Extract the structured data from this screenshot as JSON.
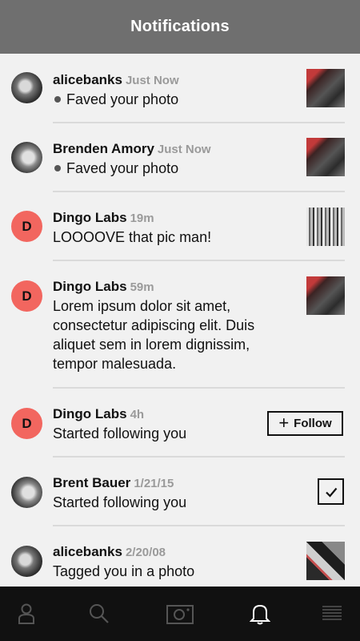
{
  "header": {
    "title": "Notifications"
  },
  "notifications": [
    {
      "user": "alicebanks",
      "time": "Just Now",
      "text": "Faved your photo",
      "dot": true,
      "avatar": "photo-icon",
      "action": "thumbnail"
    },
    {
      "user": "Brenden Amory",
      "time": "Just Now",
      "text": "Faved your photo",
      "dot": true,
      "avatar": "photo-icon",
      "action": "thumbnail"
    },
    {
      "user": "Dingo Labs",
      "time": "19m",
      "text": "LOOOOVE that pic man!",
      "avatar_letter": "D",
      "action": "thumbnail"
    },
    {
      "user": "Dingo Labs",
      "time": "59m",
      "text": "Lorem ipsum dolor sit amet, consectetur adipiscing elit. Duis aliquet sem in lorem dignissim, tempor malesuada.",
      "avatar_letter": "D",
      "action": "thumbnail"
    },
    {
      "user": "Dingo Labs",
      "time": "4h",
      "text": "Started following you",
      "avatar_letter": "D",
      "action": "follow",
      "follow_label": "Follow"
    },
    {
      "user": "Brent Bauer",
      "time": "1/21/15",
      "text": "Started following you",
      "avatar": "photo-icon",
      "action": "following"
    },
    {
      "user": "alicebanks",
      "time": "2/20/08",
      "text": "Tagged you in a photo",
      "avatar": "photo-icon",
      "action": "thumbnail"
    }
  ],
  "tabbar": {
    "items": [
      "profile-icon",
      "search-icon",
      "camera-icon",
      "bell-icon",
      "menu-icon"
    ],
    "active": "bell-icon"
  },
  "colors": {
    "header": "#6f6f6f",
    "accent": "#f2665f",
    "tabbar": "#111111",
    "background": "#f1f1f1"
  }
}
